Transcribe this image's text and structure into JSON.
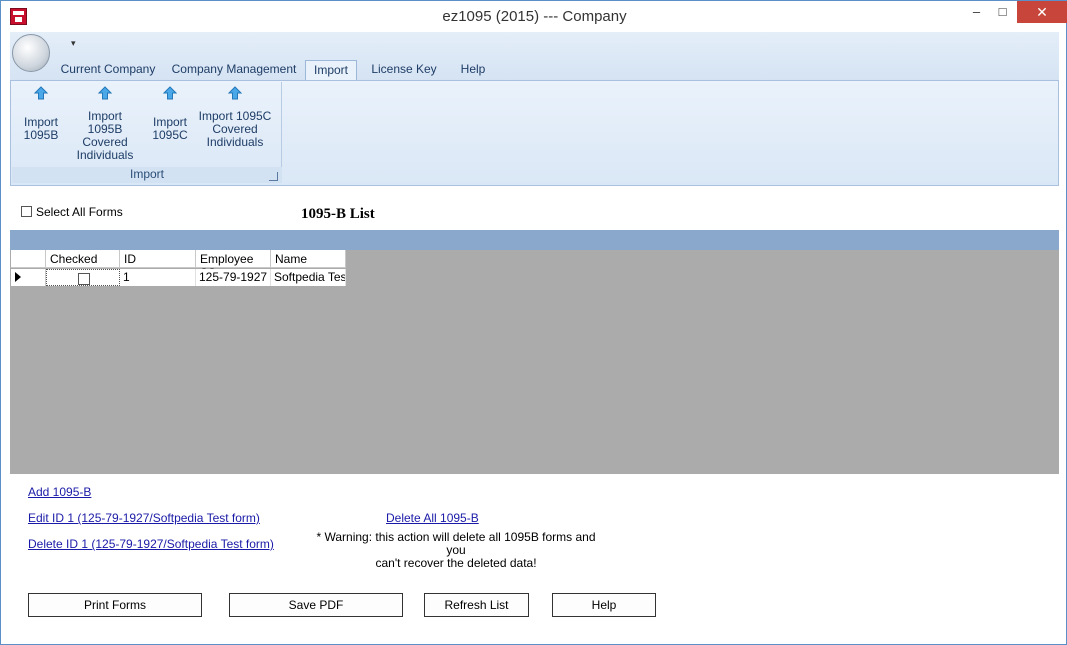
{
  "window": {
    "title": "ez1095 (2015) --- Company",
    "minimize": "‒",
    "maximize": "□",
    "close": "✕"
  },
  "qat": {
    "dropdown_glyph": "▾"
  },
  "tabs": [
    {
      "label": "Current Company"
    },
    {
      "label": "Company Management"
    },
    {
      "label": "Import"
    },
    {
      "label": "License Key"
    },
    {
      "label": "Help"
    }
  ],
  "active_tab": "Import",
  "ribbon": {
    "group_label": "Import",
    "buttons": [
      {
        "label_lines": [
          "Import",
          "1095B"
        ],
        "icon": "up-arrow-icon"
      },
      {
        "label_lines": [
          "Import 1095B",
          "Covered",
          "Individuals"
        ],
        "icon": "up-arrow-icon"
      },
      {
        "label_lines": [
          "Import",
          "1095C"
        ],
        "icon": "up-arrow-icon"
      },
      {
        "label_lines": [
          "Import 1095C",
          "Covered",
          "Individuals"
        ],
        "icon": "up-arrow-icon"
      }
    ]
  },
  "select_all_label": "Select All Forms",
  "list_title": "1095-B List",
  "grid": {
    "columns": [
      "Checked",
      "ID",
      "Employee SS",
      "Name"
    ],
    "rows": [
      {
        "checked": false,
        "id": "1",
        "employee_ss": "125-79-1927",
        "name": "Softpedia Tes"
      }
    ]
  },
  "links": {
    "add": "Add 1095-B",
    "edit": "Edit ID 1 (125-79-1927/Softpedia Test form)",
    "delete": "Delete ID 1 (125-79-1927/Softpedia Test form)",
    "delete_all": "Delete All 1095-B"
  },
  "warning_lines": [
    "* Warning: this action will delete all 1095B forms and you",
    "can't recover the deleted data!"
  ],
  "buttons": {
    "print": "Print Forms",
    "save_pdf": "Save PDF",
    "refresh": "Refresh List",
    "help": "Help"
  },
  "colors": {
    "titlebar_close": "#c7453a",
    "ribbon": "#dae7f6",
    "grid_background": "#ababab",
    "grid_header_bar": "#8aa8cc",
    "link": "#1a1aa8"
  }
}
